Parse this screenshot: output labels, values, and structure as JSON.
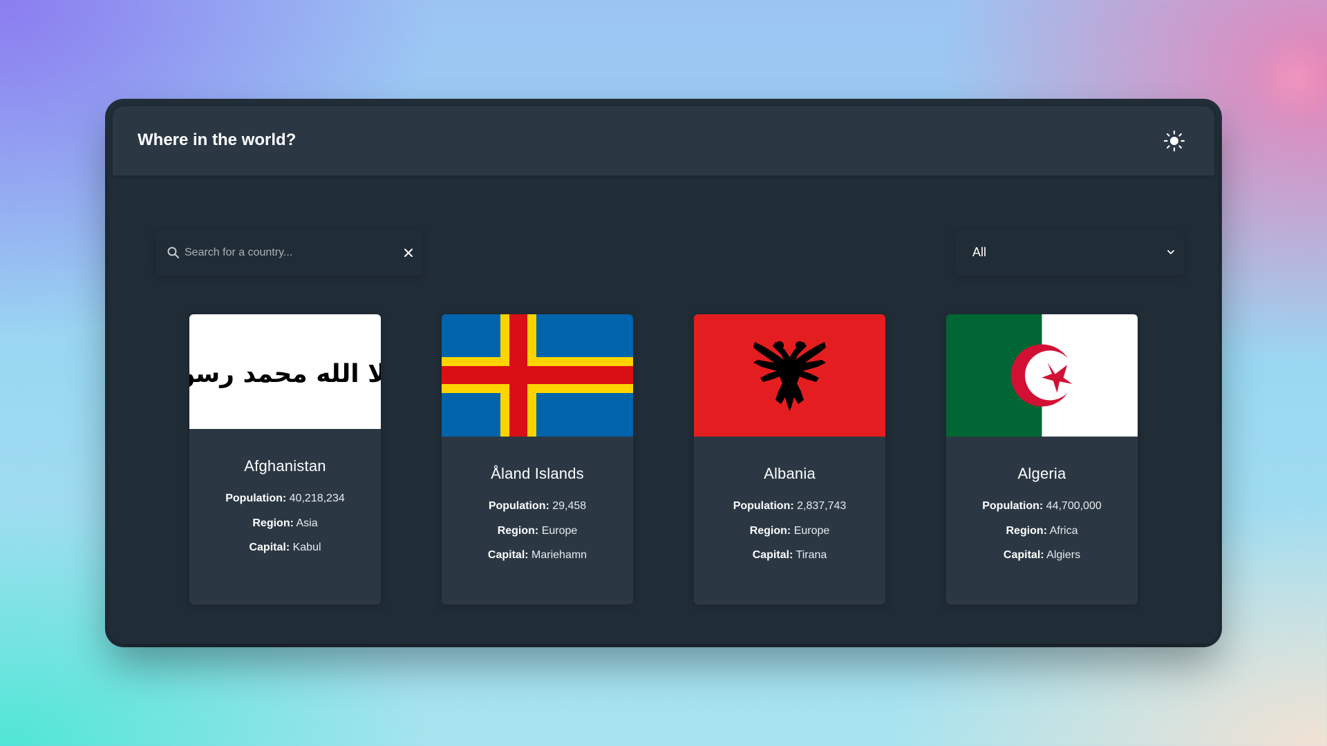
{
  "app": {
    "title": "Where in the world?",
    "theme_icon": "sun-icon"
  },
  "search": {
    "placeholder": "Search for a country...",
    "value": "",
    "icon": "search-icon",
    "clear_icon": "close-icon"
  },
  "filter": {
    "selected": "All",
    "icon": "chevron-down-icon"
  },
  "labels": {
    "population": "Population:",
    "region": "Region:",
    "capital": "Capital:"
  },
  "countries": [
    {
      "name": "Afghanistan",
      "population": "40,218,234",
      "region": "Asia",
      "capital": "Kabul",
      "flag": "afghanistan-flag",
      "flag_text": "لا إله إلا الله محمد رسول الله"
    },
    {
      "name": "Åland Islands",
      "population": "29,458",
      "region": "Europe",
      "capital": "Mariehamn",
      "flag": "aland-flag"
    },
    {
      "name": "Albania",
      "population": "2,837,743",
      "region": "Europe",
      "capital": "Tirana",
      "flag": "albania-flag"
    },
    {
      "name": "Algeria",
      "population": "44,700,000",
      "region": "Africa",
      "capital": "Algiers",
      "flag": "algeria-flag"
    }
  ],
  "colors": {
    "background": "#202c36",
    "surface": "#2b3844",
    "text": "#ffffff",
    "aland_blue": "#0064ad",
    "aland_yellow": "#ffd300",
    "aland_red": "#da0e15",
    "albania_red": "#e41e20",
    "algeria_green": "#006633",
    "algeria_red": "#d21034"
  }
}
